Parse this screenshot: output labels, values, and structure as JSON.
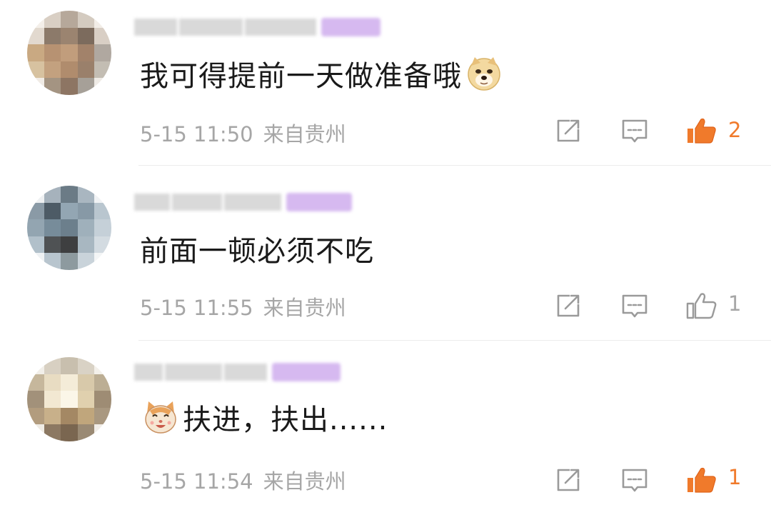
{
  "comments": [
    {
      "text": "我可得提前一天做准备哦",
      "emoji": "doge-emoji",
      "time": "5-15 11:50",
      "source": "来自贵州",
      "likes": "2",
      "liked": true
    },
    {
      "text": "前面一顿必须不吃",
      "time": "5-15 11:55",
      "source": "来自贵州",
      "likes": "1",
      "liked": false
    },
    {
      "text": "扶进，扶出......",
      "emoji": "cat-emoji",
      "time": "5-15 11:54",
      "source": "来自贵州",
      "likes": "1",
      "liked": true
    }
  ],
  "icons": {
    "share": "share-icon",
    "reply": "comment-icon",
    "like": "thumbs-up-icon"
  },
  "colors": {
    "liked": "#f07a2b",
    "meta": "#a6a6a6",
    "badge": "#d6b9f0"
  }
}
